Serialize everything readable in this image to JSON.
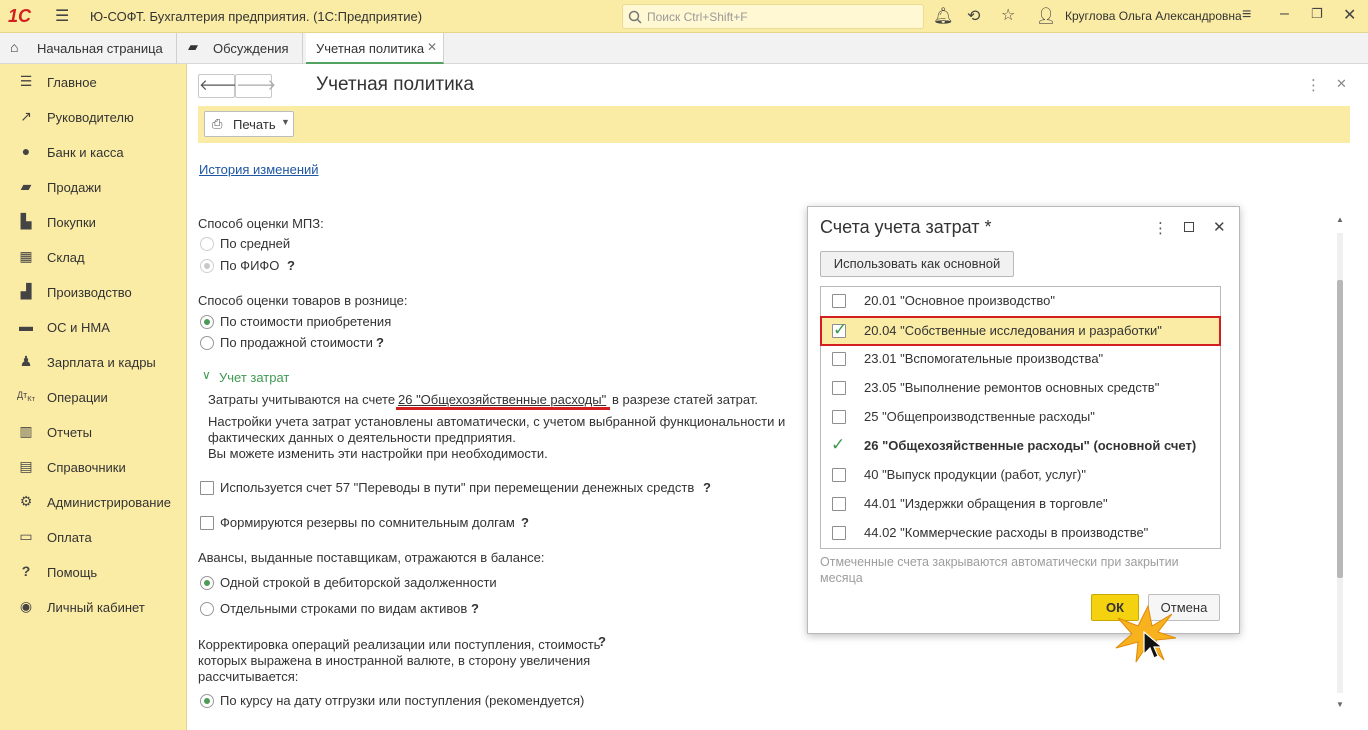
{
  "window": {
    "logo": "1С",
    "title": "Ю-СОФТ. Бухгалтерия предприятия.  (1С:Предприятие)",
    "search_placeholder": "Поиск Ctrl+Shift+F",
    "user": "Круглова Ольга Александровна"
  },
  "tabs": [
    {
      "label": "Начальная страница"
    },
    {
      "label": "Обсуждения"
    },
    {
      "label": "Учетная политика"
    }
  ],
  "sidebar": {
    "items": [
      {
        "label": "Главное",
        "icon": "menu-icon"
      },
      {
        "label": "Руководителю",
        "icon": "trend-icon"
      },
      {
        "label": "Банк и касса",
        "icon": "coin-icon"
      },
      {
        "label": "Продажи",
        "icon": "bag-icon"
      },
      {
        "label": "Покупки",
        "icon": "cart-icon"
      },
      {
        "label": "Склад",
        "icon": "warehouse-icon"
      },
      {
        "label": "Производство",
        "icon": "factory-icon"
      },
      {
        "label": "ОС и НМА",
        "icon": "truck-icon"
      },
      {
        "label": "Зарплата и кадры",
        "icon": "person-icon"
      },
      {
        "label": "Операции",
        "icon": "dt-kt-icon"
      },
      {
        "label": "Отчеты",
        "icon": "bar-chart-icon"
      },
      {
        "label": "Справочники",
        "icon": "book-icon"
      },
      {
        "label": "Администрирование",
        "icon": "gear-icon"
      },
      {
        "label": "Оплата",
        "icon": "card-icon"
      },
      {
        "label": "Помощь",
        "icon": "question-icon"
      },
      {
        "label": "Личный кабинет",
        "icon": "account-icon"
      }
    ]
  },
  "form": {
    "title": "Учетная политика",
    "print_label": "Печать",
    "history_link": "История изменений",
    "mpz": {
      "label": "Способ оценки МПЗ:",
      "opt1": "По средней",
      "opt2": "По ФИФО"
    },
    "retail": {
      "label": "Способ оценки товаров в рознице:",
      "opt1": "По стоимости приобретения",
      "opt2": "По продажной стоимости"
    },
    "costs": {
      "group": "Учет затрат",
      "text_before": "Затраты учитываются на счете",
      "account_link": "26 \"Общехозяйственные расходы\"",
      "text_after": "в разрезе статей затрат.",
      "note1": "Настройки учета затрат установлены автоматически, с учетом выбранной функциональности и",
      "note2": "фактических данных о деятельности предприятия.",
      "note3": "Вы можете изменить эти настройки при необходимости."
    },
    "check57": "Используется счет 57 \"Переводы в пути\" при перемещении денежных средств",
    "reserves": "Формируются резервы по сомнительным долгам",
    "advances": {
      "label": "Авансы, выданные поставщикам, отражаются в балансе:",
      "opt1": "Одной строкой в дебиторской задолженности",
      "opt2": "Отдельными строками по видам активов"
    },
    "correction": {
      "line1": "Корректировка операций реализации или поступления, стоимость",
      "line2": "которых выражена в иностранной валюте, в сторону увеличения",
      "line3": "рассчитывается:",
      "opt1": "По курсу на дату отгрузки или поступления (рекомендуется)"
    },
    "help_mark": "?"
  },
  "dialog": {
    "title": "Счета учета затрат *",
    "use_main_button": "Использовать как основной",
    "accounts": [
      {
        "label": "20.01 \"Основное производство\"",
        "checked": false
      },
      {
        "label": "20.04 \"Собственные исследования и разработки\"",
        "checked": true
      },
      {
        "label": "23.01 \"Вспомогательные производства\"",
        "checked": false
      },
      {
        "label": "23.05 \"Выполнение ремонтов основных средств\"",
        "checked": false
      },
      {
        "label": "25 \"Общепроизводственные расходы\"",
        "checked": false
      },
      {
        "label": "26 \"Общехозяйственные расходы\" (основной счет)",
        "checked": true
      },
      {
        "label": "40 \"Выпуск продукции (работ, услуг)\"",
        "checked": false
      },
      {
        "label": "44.01 \"Издержки обращения в торговле\"",
        "checked": false
      },
      {
        "label": "44.02 \"Коммерческие расходы в производстве\"",
        "checked": false
      }
    ],
    "note_line1": "Отмеченные счета закрываются автоматически при закрытии",
    "note_line2": "месяца",
    "ok": "ОК",
    "cancel": "Отмена"
  },
  "colors": {
    "accent_yellow": "#fbeca5",
    "highlight_red": "#d31f1f",
    "check_green": "#3d9a4d",
    "link_blue": "#1d56a4"
  }
}
